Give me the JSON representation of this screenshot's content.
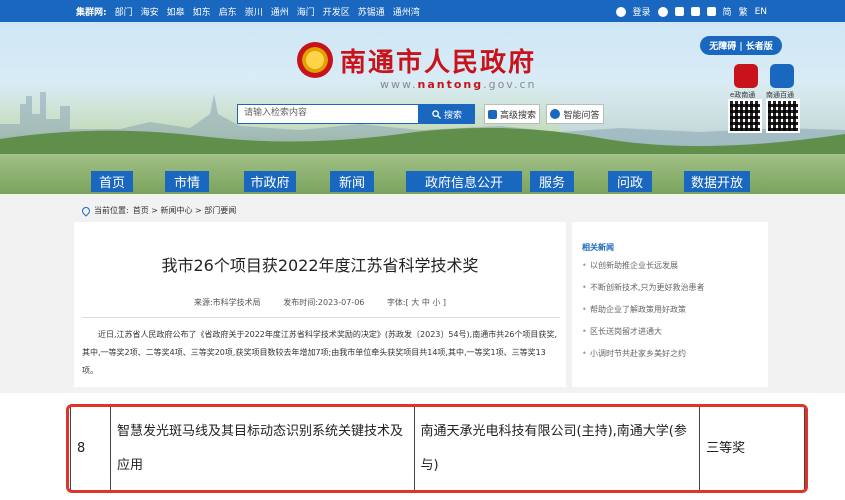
{
  "topbar": {
    "portal_label": "集群网:",
    "links": [
      "部门",
      "海安",
      "如皋",
      "如东",
      "启东",
      "崇川",
      "通州",
      "海门",
      "开发区",
      "苏锡通",
      "通州湾"
    ],
    "login": "登录",
    "lang_simple": "简",
    "lang_trad": "繁",
    "lang_en": "EN"
  },
  "header": {
    "site_title": "南通市人民政府",
    "site_url_pre": "www.",
    "site_url_brand": "nantong",
    "site_url_post": ".gov.cn",
    "search_placeholder": "请输入检索内容",
    "search_button": "搜索",
    "advanced_search": "高级搜索",
    "smart_qa": "智能问答",
    "accessibility": "无障碍 | 长者版",
    "app1_label": "e政南通",
    "app2_label": "南通百通"
  },
  "nav": {
    "items": [
      "首页",
      "市情",
      "市政府",
      "新闻",
      "政府信息公开",
      "服务",
      "问政",
      "数据开放"
    ]
  },
  "breadcrumb": {
    "label": "当前位置:",
    "path": "首页 > 新闻中心 > 部门要闻"
  },
  "article": {
    "title": "我市26个项目获2022年度江苏省科学技术奖",
    "source": "来源:市科学技术局",
    "date": "发布时间:2023-07-06",
    "font_size": "字体:[ 大 中 小 ]",
    "body": "近日,江苏省人民政府公布了《省政府关于2022年度江苏省科学技术奖励的决定》(苏政发〔2023〕54号),南通市共26个项目获奖,其中,一等奖2项、二等奖4项、三等奖20项,获奖项目数较去年增加7项;由我市单位牵头获奖项目共14项,其中,一等奖1项、三等奖13项。"
  },
  "sidebar": {
    "title": "相关新闻",
    "items": [
      "以创新助推企业长远发展",
      "不断创新技术,只为更好救治患者",
      "帮助企业了解政策用好政策",
      "区长送岗留才进通大",
      "小调时节共赴家乡美好之约"
    ]
  },
  "table": {
    "row": {
      "index": "8",
      "project": "智慧发光斑马线及其目标动态识别系统关键技术及应用",
      "org": "南通天承光电科技有限公司(主持),南通大学(参与)",
      "award": "三等奖"
    }
  },
  "colors": {
    "primary": "#1a67c0",
    "brand_red": "#c8131a",
    "highlight": "#e2322c"
  }
}
